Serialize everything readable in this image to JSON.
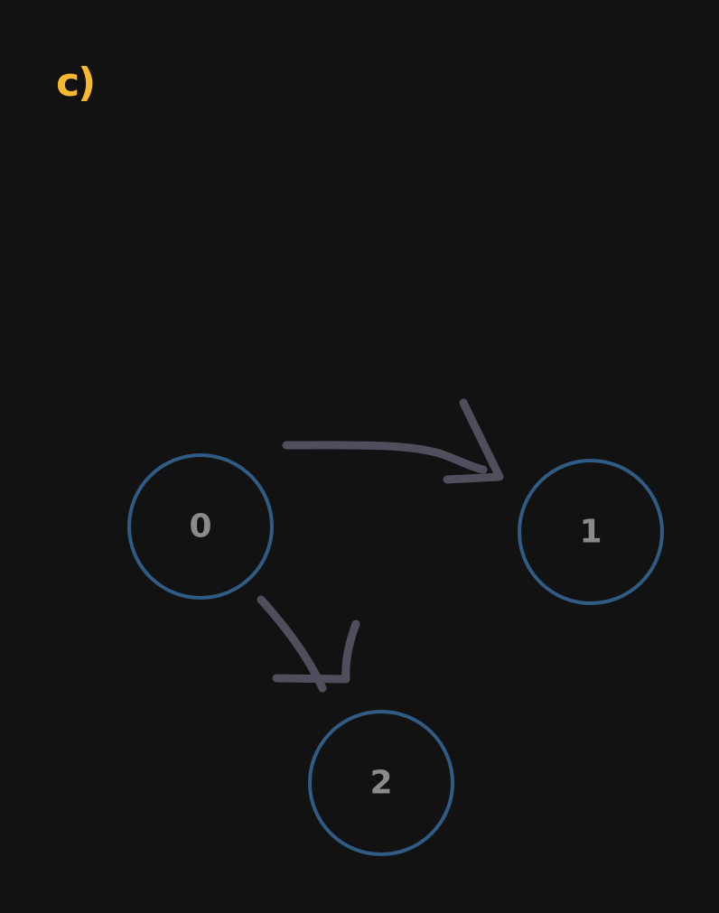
{
  "label": "c)",
  "colors": {
    "background": "#121212",
    "label": "#f5b82e",
    "node_stroke": "#2f5b84",
    "node_text": "#8a8a8a",
    "edge": "#4e4e5c"
  },
  "nodes": [
    {
      "id": "0",
      "label": "0"
    },
    {
      "id": "1",
      "label": "1"
    },
    {
      "id": "2",
      "label": "2"
    }
  ],
  "edges": [
    {
      "from": "0",
      "to": "1"
    },
    {
      "from": "0",
      "to": "2"
    }
  ]
}
